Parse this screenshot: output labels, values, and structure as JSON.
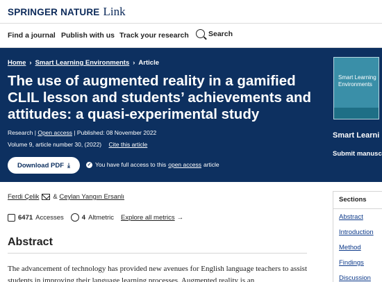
{
  "header": {
    "brand": "SPRINGER NATURE",
    "product": "Link"
  },
  "nav": {
    "find_journal": "Find a journal",
    "publish": "Publish with us",
    "track": "Track your research",
    "search": "Search"
  },
  "breadcrumb": {
    "home": "Home",
    "journal": "Smart Learning Environments",
    "current": "Article"
  },
  "article": {
    "title": "The use of augmented reality in a gamified CLIL lesson and students’ achievements and attitudes: a quasi-experimental study",
    "type": "Research",
    "access": "Open access",
    "published": "Published: 08 November 2022",
    "volume": "Volume 9, article number 30, (2022)",
    "cite": "Cite this article",
    "download": "Download PDF",
    "access_note_pre": "You have full access to this",
    "access_note_link": "open access",
    "access_note_post": "article"
  },
  "journal_panel": {
    "cover_title": "Smart Learning Environments",
    "name": "Smart Learni",
    "submit": "Submit manuscri"
  },
  "authors": {
    "first": "Ferdi Çelik",
    "sep": "&",
    "second": "Ceylan Yangın Ersanlı"
  },
  "metrics": {
    "accesses_count": "6471",
    "accesses_label": "Accesses",
    "altmetric_count": "4",
    "altmetric_label": "Altmetric",
    "explore": "Explore all metrics",
    "arrow": "→"
  },
  "abstract": {
    "heading": "Abstract",
    "text": "The advancement of technology has provided new avenues for English language teachers to assist students in improving their language learning processes. Augmented reality is an"
  },
  "sections": {
    "heading": "Sections",
    "items": [
      "Abstract",
      "Introduction",
      "Method",
      "Findings",
      "Discussion"
    ]
  },
  "colors": {
    "hero_bg": "#0d3060",
    "link": "#0d3a8a"
  }
}
